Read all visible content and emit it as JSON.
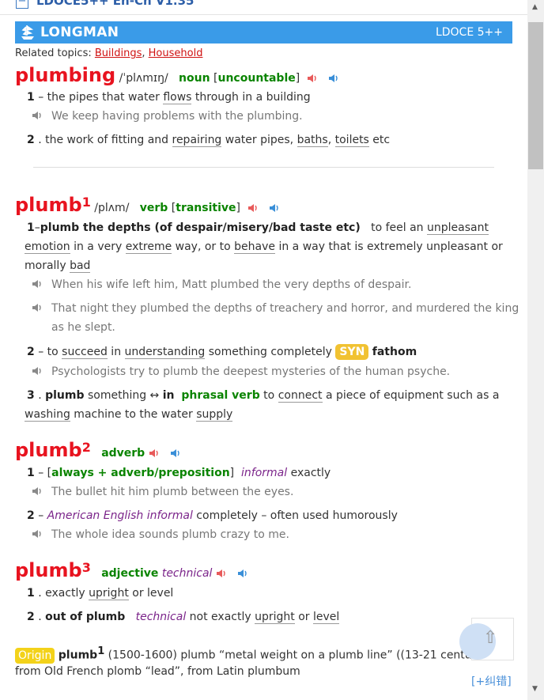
{
  "top": {
    "dict_title": "LDOCE5++ En-Ch V1.35"
  },
  "banner": {
    "brand": "LONGMAN",
    "version": "LDOCE 5++"
  },
  "topics": {
    "label": "Related topics:",
    "items": [
      "Buildings",
      "Household"
    ],
    "sep": ", "
  },
  "plumbing": {
    "headword": "plumbing",
    "pron": "/ˈplʌmɪŋ/",
    "pos": "noun",
    "gram": "uncountable",
    "senses": [
      {
        "num": "1",
        "parts": [
          "the pipes that water ",
          "flows",
          " through in a building"
        ],
        "example": "We keep having problems with the plumbing."
      },
      {
        "num": "2",
        "parts": [
          "the work of fitting and ",
          "repairing",
          " water pipes, ",
          "baths",
          ", ",
          "toilets",
          " etc"
        ]
      }
    ]
  },
  "plumb1": {
    "headword": "plumb",
    "hom": "1",
    "pron": "/plʌm/",
    "pos": "verb",
    "gram": "transitive",
    "s1": {
      "num": "1",
      "phrase": "plumb the depths (of despair/misery/bad taste etc)",
      "def_l1": "to feel an ",
      "def_l1_link": "unpleasant",
      "def_l2": [
        "emotion",
        " in a very ",
        "extreme",
        " way, or to ",
        "behave",
        " in a way that is extremely unpleasant or"
      ],
      "def_l3": [
        "morally ",
        "bad"
      ],
      "ex1": "When his wife left him, Matt plumbed the very depths of despair.",
      "ex2_l1": "That night they plumbed the depths of treachery and horror, and murdered the king",
      "ex2_l2": "as he slept."
    },
    "s2": {
      "num": "2",
      "parts": [
        "to ",
        "succeed",
        " in ",
        "understanding",
        " something completely "
      ],
      "syn_label": "SYN",
      "syn": "fathom",
      "example": "Psychologists try to plumb the deepest mysteries of the human psyche."
    },
    "s3": {
      "num": "3",
      "phrase": "plumb",
      "phrase_mid": " something ↔ ",
      "phrase_in": "in",
      "pos": "phrasal verb",
      "def_l1": [
        " to ",
        "connect",
        " a piece of equipment such as a"
      ],
      "def_l2": [
        "washing",
        " machine to the water ",
        "supply"
      ]
    }
  },
  "plumb2": {
    "headword": "plumb",
    "hom": "2",
    "pos": "adverb",
    "s1": {
      "num": "1",
      "gram": "always + adverb/preposition",
      "reg": "informal",
      "def": " exactly",
      "example": "The bullet hit him plumb between the eyes."
    },
    "s2": {
      "num": "2",
      "geo": "American English",
      "reg": "informal",
      "def": " completely – often used humorously",
      "example": "The whole idea sounds plumb crazy to me."
    }
  },
  "plumb3": {
    "headword": "plumb",
    "hom": "3",
    "pos": "adjective",
    "reg": "technical",
    "s1": {
      "num": "1",
      "parts": [
        "exactly ",
        "upright",
        " or level"
      ]
    },
    "s2": {
      "num": "2",
      "phrase": "out of plumb",
      "reg": "technical",
      "parts": [
        " not exactly ",
        "upright",
        " or ",
        "level"
      ]
    }
  },
  "etym": {
    "label": "Origin",
    "word": "plumb",
    "hom": "1",
    "l1": " (1500-1600) plumb “metal weight on a plumb line” ((13-21 centuries)),",
    "l2": "from Old French plomb “lead”, from Latin plumbum"
  },
  "correction": "[+纠错]",
  "colors": {
    "headword": "#e8131f",
    "pos": "#0a8400",
    "banner": "#3a9be8",
    "register": "#7b248a",
    "syn_bg": "#f1c232",
    "origin_bg": "#f3d21a"
  },
  "icons": {
    "speaker_uk": "speaker-red-icon",
    "speaker_us": "speaker-blue-icon",
    "example_speaker": "speaker-grey-icon"
  }
}
